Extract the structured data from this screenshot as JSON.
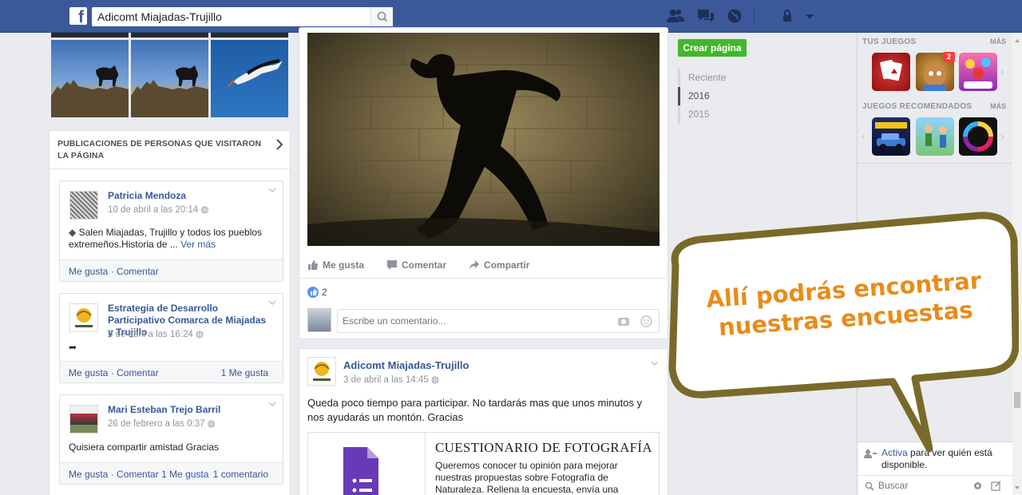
{
  "topbar": {
    "logo": "f",
    "search_value": "Adicomt Miajadas-Trujillo",
    "icons": [
      "friends-icon",
      "messages-icon",
      "notifications-globe-icon",
      "privacy-lock-icon",
      "account-dropdown-icon"
    ]
  },
  "visitors": {
    "heading": "PUBLICACIONES DE PERSONAS QUE VISITARON LA PÁGINA",
    "posts": [
      {
        "name": "Patricia Mendoza",
        "date": "10 de abril a las 20:14",
        "text": "Salen Miajadas, Trujillo y todos los pueblos extremeños.Historia de ...",
        "more": "Ver más",
        "like": "Me gusta",
        "comment": "Comentar"
      },
      {
        "name": "Estrategia de Desarrollo Participativo Comarca de Miajadas y Trujillo",
        "date": "6 de abril a las 16:24",
        "like": "Me gusta",
        "comment": "Comentar",
        "likes_count": "1 Me gusta"
      },
      {
        "name": "Mari Esteban Trejo Barril",
        "date": "26 de febrero a las 0:37",
        "text": "Quisiera compartir amistad Gracias",
        "like": "Me gusta",
        "comment": "Comentar",
        "likes_count": "1 Me gusta",
        "comments_count": "1 comentario"
      }
    ]
  },
  "main_post": {
    "actions": {
      "like": "Me gusta",
      "comment": "Comentar",
      "share": "Compartir"
    },
    "likes": "2",
    "comment_placeholder": "Escribe un comentario..."
  },
  "second_post": {
    "author": "Adicomt Miajadas-Trujillo",
    "date": "3 de abril a las 14:45",
    "text": "Queda poco tiempo para participar. No tardarás mas que unos minutos y nos ayudarás un montón. Gracias",
    "link_title": "CUESTIONARIO DE FOTOGRAFÍA",
    "link_desc": "Queremos conocer tu opinión para mejorar nuestras propuestas sobre Fotografía de Naturaleza. Rellena la encuesta, envía una fotografía"
  },
  "timeline": {
    "create_page": "Crear página",
    "years": [
      "Reciente",
      "2016",
      "2015"
    ],
    "active_year": "2016"
  },
  "sidebar": {
    "your_games": "TUS JUEGOS",
    "recommended": "JUEGOS RECOMENDADOS",
    "more": "MÁS",
    "badge": "2",
    "chat_active": "Activa",
    "chat_text": "para ver quién está disponible.",
    "chat_search_placeholder": "Buscar"
  },
  "overlay": {
    "text": "Allí podrás encontrar nuestras encuestas",
    "color": "#e88c1a",
    "border_color": "#7a6a2a"
  }
}
